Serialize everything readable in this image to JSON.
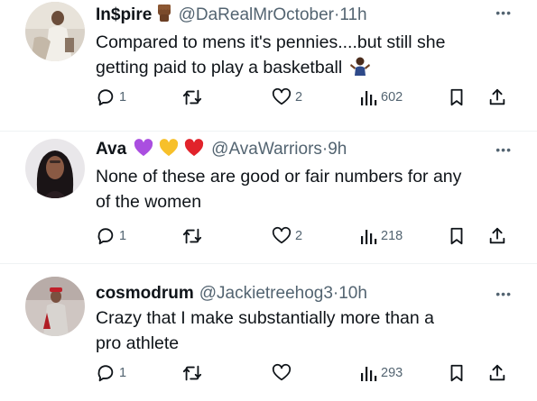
{
  "tweets": [
    {
      "name": "In$pire",
      "handle": "@DaRealMrOctober",
      "time": "11h",
      "text_lines": [
        "Compared to mens it's pennies....but still she",
        "getting paid to play a basketball"
      ],
      "name_emojis": [
        "raised-fist-emoji"
      ],
      "text_emoji": "person-shrugging-emoji",
      "replies": "1",
      "retweets": "",
      "likes": "2",
      "views": "602"
    },
    {
      "name": "Ava",
      "handle": "@AvaWarriors",
      "time": "9h",
      "text_lines": [
        "None of these are good or fair numbers for any",
        "of the women"
      ],
      "name_emojis": [
        "purple-heart-emoji",
        "yellow-heart-emoji",
        "red-heart-emoji"
      ],
      "replies": "1",
      "retweets": "",
      "likes": "2",
      "views": "218"
    },
    {
      "name": "cosmodrum",
      "handle": "@Jackietreehog3",
      "time": "10h",
      "text_lines": [
        "Crazy that I make substantially more than a",
        "pro athlete"
      ],
      "name_emojis": [],
      "replies": "1",
      "retweets": "",
      "likes": "",
      "views": "293"
    }
  ],
  "separator_dot": "·",
  "more_glyph": "•••",
  "colors": {
    "text": "#0f1419",
    "muted": "#536471",
    "separator": "#eff3f4"
  }
}
